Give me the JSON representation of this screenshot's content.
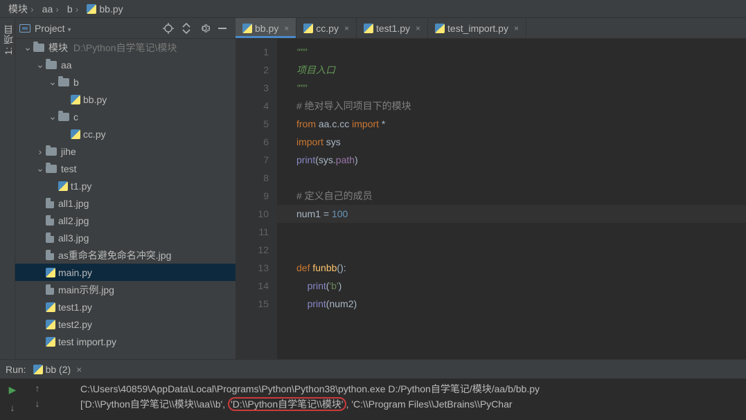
{
  "breadcrumb": [
    "模块",
    "aa",
    "b",
    "bb.py"
  ],
  "leftstrip": {
    "tab": "1: 项目"
  },
  "project": {
    "title": "Project",
    "root_hint": "D:\\Python自学笔记\\模块",
    "tree": [
      {
        "depth": 0,
        "tw": "v",
        "icon": "folder",
        "label": "模块",
        "hint": "D:\\Python自学笔记\\模块"
      },
      {
        "depth": 1,
        "tw": "v",
        "icon": "folder",
        "label": "aa"
      },
      {
        "depth": 2,
        "tw": "v",
        "icon": "folder",
        "label": "b"
      },
      {
        "depth": 3,
        "tw": "",
        "icon": "py",
        "label": "bb.py"
      },
      {
        "depth": 2,
        "tw": "v",
        "icon": "folder",
        "label": "c"
      },
      {
        "depth": 3,
        "tw": "",
        "icon": "py",
        "label": "cc.py"
      },
      {
        "depth": 1,
        "tw": ">",
        "icon": "folder",
        "label": "jihe"
      },
      {
        "depth": 1,
        "tw": "v",
        "icon": "folder",
        "label": "test"
      },
      {
        "depth": 2,
        "tw": "",
        "icon": "py",
        "label": "t1.py"
      },
      {
        "depth": 1,
        "tw": "",
        "icon": "file",
        "label": "all1.jpg"
      },
      {
        "depth": 1,
        "tw": "",
        "icon": "file",
        "label": "all2.jpg"
      },
      {
        "depth": 1,
        "tw": "",
        "icon": "file",
        "label": "all3.jpg"
      },
      {
        "depth": 1,
        "tw": "",
        "icon": "file",
        "label": "as重命名避免命名冲突.jpg"
      },
      {
        "depth": 1,
        "tw": "",
        "icon": "py",
        "label": "main.py",
        "selected": true
      },
      {
        "depth": 1,
        "tw": "",
        "icon": "file",
        "label": "main示例.jpg"
      },
      {
        "depth": 1,
        "tw": "",
        "icon": "py",
        "label": "test1.py"
      },
      {
        "depth": 1,
        "tw": "",
        "icon": "py",
        "label": "test2.py"
      },
      {
        "depth": 1,
        "tw": "",
        "icon": "py",
        "label": "test import.py"
      }
    ]
  },
  "tabs": [
    {
      "label": "bb.py",
      "active": true
    },
    {
      "label": "cc.py"
    },
    {
      "label": "test1.py"
    },
    {
      "label": "test_import.py"
    }
  ],
  "code": {
    "current_line": 10,
    "lines": [
      {
        "n": 1,
        "kind": "doc",
        "text": "\"\"\""
      },
      {
        "n": 2,
        "kind": "doc",
        "text": "项目入口"
      },
      {
        "n": 3,
        "kind": "doc",
        "text": "\"\"\""
      },
      {
        "n": 4,
        "kind": "cm",
        "text": "# 绝对导入同项目下的模块"
      },
      {
        "n": 5,
        "kind": "imp",
        "tokens": [
          "from",
          " aa.c.cc ",
          "import",
          " *"
        ]
      },
      {
        "n": 6,
        "kind": "imp2",
        "tokens": [
          "import",
          " sys"
        ]
      },
      {
        "n": 7,
        "kind": "call",
        "tokens": [
          "print",
          "(sys.",
          "path",
          ")"
        ]
      },
      {
        "n": 8,
        "kind": "blank",
        "text": ""
      },
      {
        "n": 9,
        "kind": "cm",
        "text": "# 定义自己的成员"
      },
      {
        "n": 10,
        "kind": "asn",
        "tokens": [
          "num1 = ",
          "100"
        ]
      },
      {
        "n": 11,
        "kind": "blank",
        "text": ""
      },
      {
        "n": 12,
        "kind": "blank",
        "text": ""
      },
      {
        "n": 13,
        "kind": "def",
        "tokens": [
          "def ",
          "funbb",
          "():"
        ]
      },
      {
        "n": 14,
        "kind": "call",
        "indent": "    ",
        "tokens": [
          "print",
          "(",
          "'b'",
          ")"
        ]
      },
      {
        "n": 15,
        "kind": "callp",
        "indent": "    ",
        "tokens": [
          "print",
          "(num2)"
        ]
      }
    ]
  },
  "run": {
    "label": "Run:",
    "tab": "bb (2)",
    "lines": [
      "C:\\Users\\40859\\AppData\\Local\\Programs\\Python\\Python38\\python.exe D:/Python自学笔记/模块/aa/b/bb.py",
      {
        "pre": "['D:\\\\Python自学笔记\\\\模块\\\\aa\\\\b', ",
        "hl": "'D:\\\\Python自学笔记\\\\模块'",
        "post": ", 'C:\\\\Program Files\\\\JetBrains\\\\PyChar"
      }
    ]
  }
}
